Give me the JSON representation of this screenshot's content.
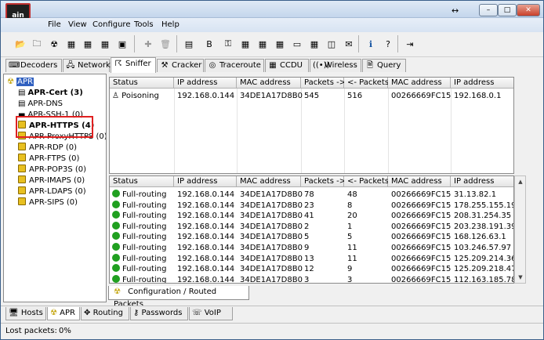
{
  "app": {
    "icon_text": "ain"
  },
  "menu": [
    "File",
    "View",
    "Configure",
    "Tools",
    "Help"
  ],
  "tabs": [
    "Decoders",
    "Network",
    "Sniffer",
    "Cracker",
    "Traceroute",
    "CCDU",
    "Wireless",
    "Query"
  ],
  "tree": {
    "root": "APR",
    "items": [
      "APR-Cert (3)",
      "APR-DNS",
      "APR-SSH-1 (0)",
      "APR-HTTPS (4)",
      "APR-ProxyHTTPS (0)",
      "APR-RDP (0)",
      "APR-FTPS (0)",
      "APR-POP3S (0)",
      "APR-IMAPS (0)",
      "APR-LDAPS (0)",
      "APR-SIPS (0)"
    ]
  },
  "top_table": {
    "headers": [
      "Status",
      "IP address",
      "MAC address",
      "Packets ->",
      "<- Packets",
      "MAC address",
      "IP address"
    ],
    "rows": [
      [
        "Poisoning",
        "192.168.0.144",
        "34DE1A17D8B0",
        "545",
        "516",
        "00266669FC15",
        "192.168.0.1"
      ]
    ]
  },
  "bottom_table": {
    "headers": [
      "Status",
      "IP address",
      "MAC address",
      "Packets ->",
      "<- Packets",
      "MAC address",
      "IP address"
    ],
    "rows": [
      [
        "Full-routing",
        "192.168.0.144",
        "34DE1A17D8B0",
        "78",
        "48",
        "00266669FC15",
        "31.13.82.1"
      ],
      [
        "Full-routing",
        "192.168.0.144",
        "34DE1A17D8B0",
        "23",
        "8",
        "00266669FC15",
        "178.255.155.19"
      ],
      [
        "Full-routing",
        "192.168.0.144",
        "34DE1A17D8B0",
        "41",
        "20",
        "00266669FC15",
        "208.31.254.35"
      ],
      [
        "Full-routing",
        "192.168.0.144",
        "34DE1A17D8B0",
        "2",
        "1",
        "00266669FC15",
        "203.238.191.39"
      ],
      [
        "Full-routing",
        "192.168.0.144",
        "34DE1A17D8B0",
        "5",
        "5",
        "00266669FC15",
        "168.126.63.1"
      ],
      [
        "Full-routing",
        "192.168.0.144",
        "34DE1A17D8B0",
        "9",
        "11",
        "00266669FC15",
        "103.246.57.97"
      ],
      [
        "Full-routing",
        "192.168.0.144",
        "34DE1A17D8B0",
        "13",
        "11",
        "00266669FC15",
        "125.209.214.36"
      ],
      [
        "Full-routing",
        "192.168.0.144",
        "34DE1A17D8B0",
        "12",
        "9",
        "00266669FC15",
        "125.209.218.47"
      ],
      [
        "Full-routing",
        "192.168.0.144",
        "34DE1A17D8B0",
        "3",
        "3",
        "00266669FC15",
        "112.163.185.78"
      ]
    ]
  },
  "config_tab": "Configuration / Routed Packets",
  "bottom_tabs": [
    "Hosts",
    "APR",
    "Routing",
    "Passwords",
    "VoIP"
  ],
  "status": {
    "label": "Lost packets:",
    "value": "0%"
  }
}
